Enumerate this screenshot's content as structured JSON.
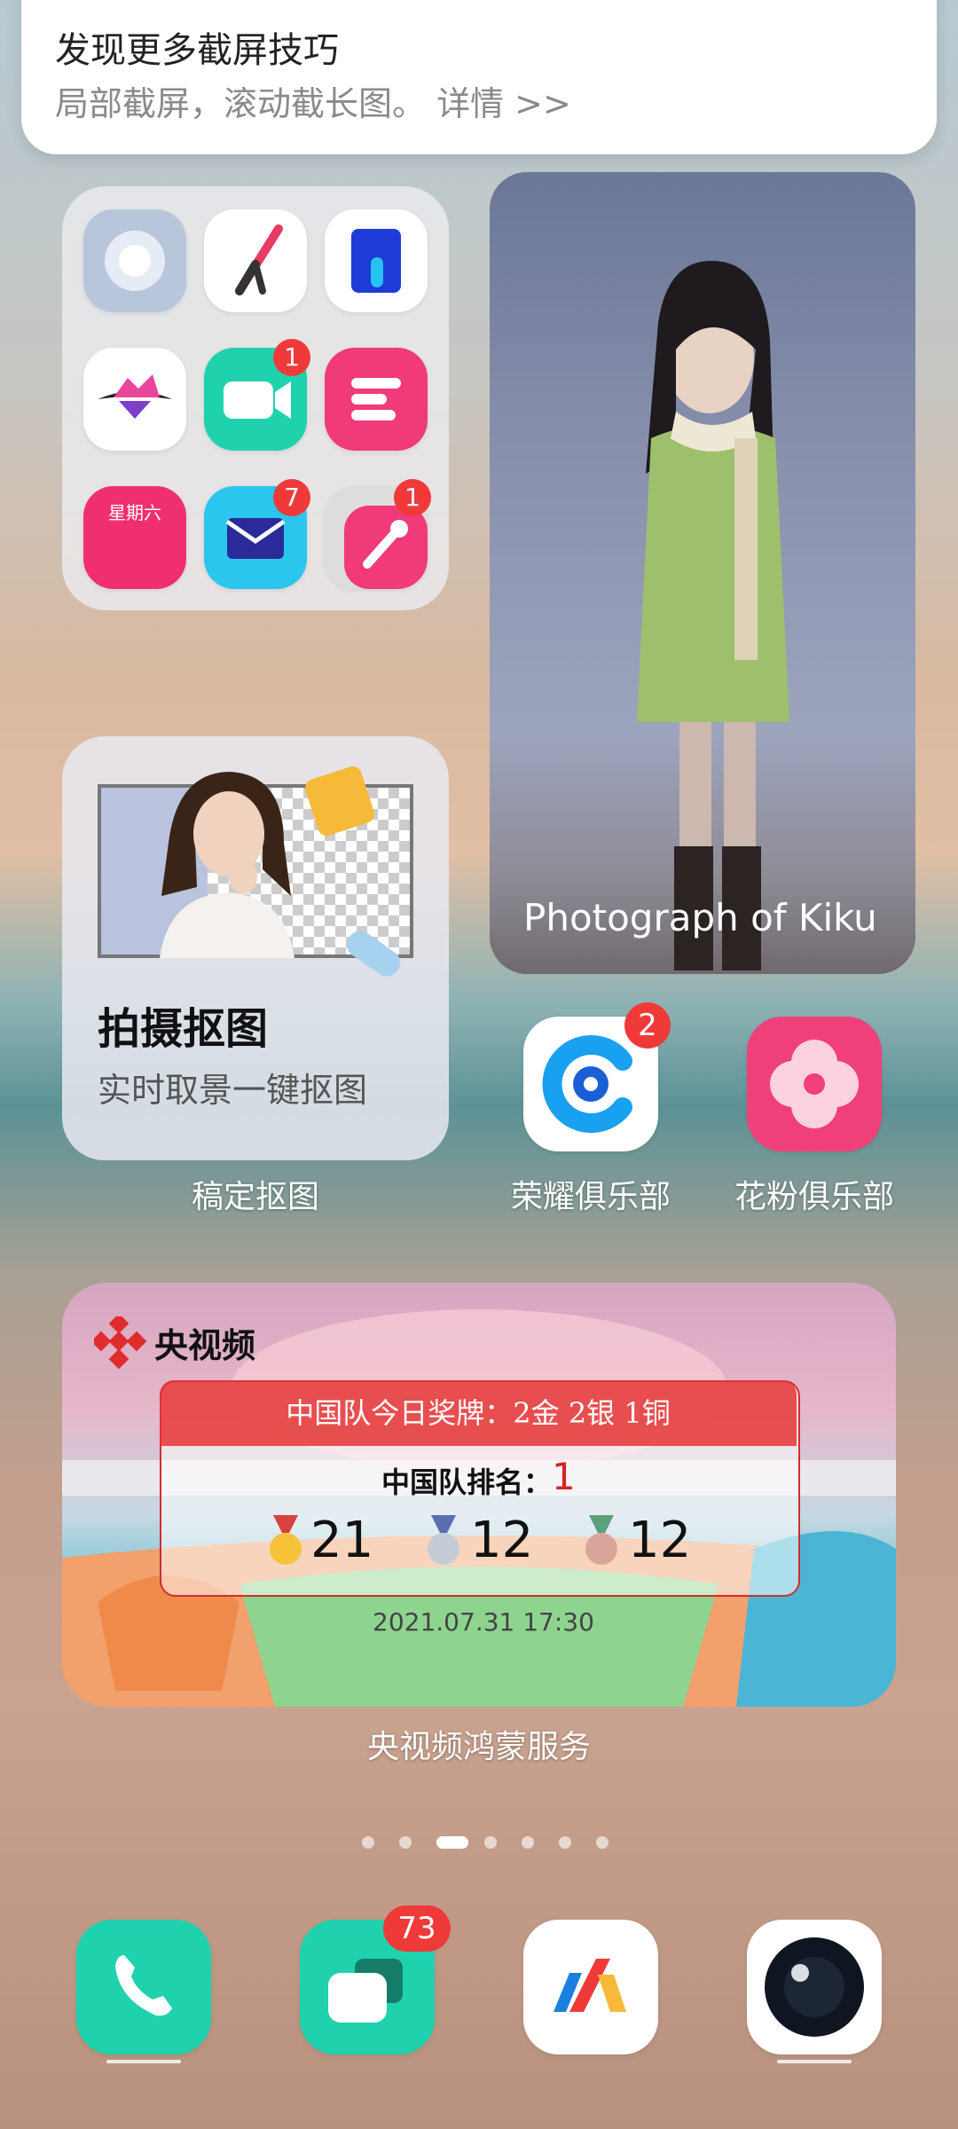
{
  "notification": {
    "title": "发现更多截屏技巧",
    "subtitle": "局部截屏，滚动截长图。 详情 >>"
  },
  "folder": {
    "calendar_weekday": "星期六",
    "badges": {
      "video": "1",
      "mail": "7",
      "brush": "1"
    }
  },
  "photo_widget": {
    "caption": "Photograph of Kiku"
  },
  "cutout_widget": {
    "title": "拍摄抠图",
    "subtitle": "实时取景一键抠图",
    "label": "稿定抠图"
  },
  "apps": {
    "honor_club": {
      "label": "荣耀俱乐部",
      "badge": "2"
    },
    "huafen_club": {
      "label": "花粉俱乐部"
    }
  },
  "cctv_widget": {
    "logo_text": "央视频",
    "today_medals": "中国队今日奖牌：2金  2银  1铜",
    "rank_label": "中国队排名：",
    "rank_value": "1",
    "gold": "21",
    "silver": "12",
    "bronze": "12",
    "timestamp": "2021.07.31 17:30",
    "label": "央视频鸿蒙服务"
  },
  "page_indicator": {
    "count": 7,
    "active_index": 2
  },
  "dock": {
    "messages_badge": "73"
  },
  "colors": {
    "badge": "#f03a3a",
    "teal": "#1fd2ad",
    "pink": "#f03a7a"
  }
}
